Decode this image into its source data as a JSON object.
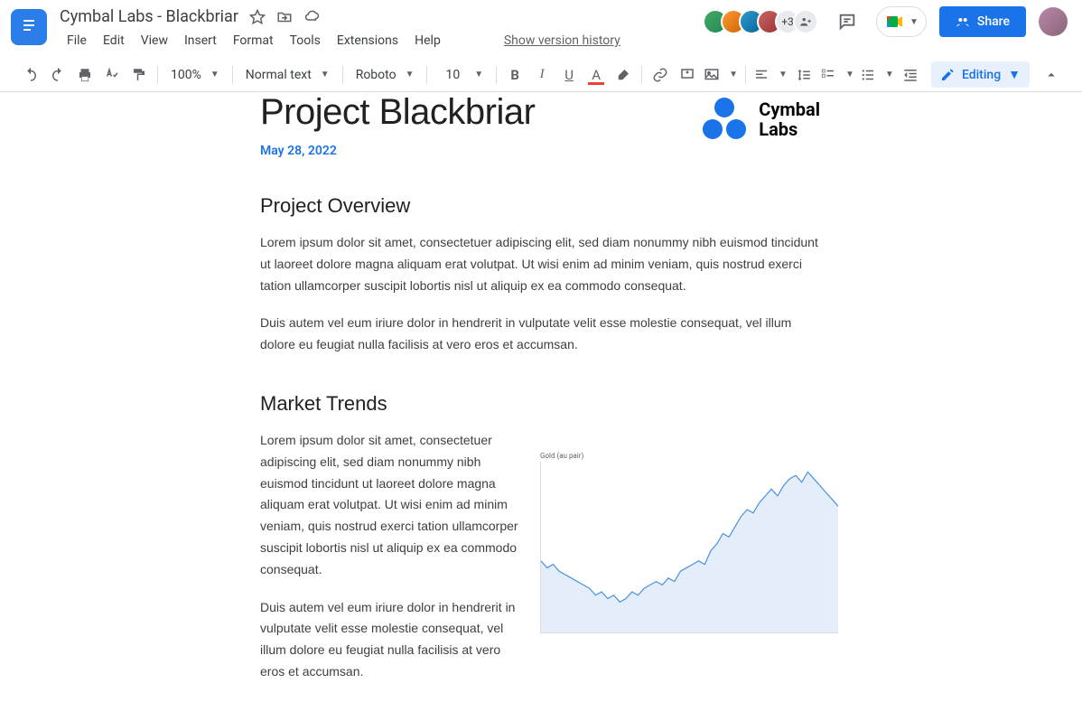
{
  "header": {
    "doc_title": "Cymbal Labs - Blackbriar",
    "menus": [
      "File",
      "Edit",
      "View",
      "Insert",
      "Format",
      "Tools",
      "Extensions",
      "Help"
    ],
    "version_link": "Show version history",
    "avatars_more": "+3",
    "share_label": "Share"
  },
  "toolbar": {
    "zoom": "100%",
    "style": "Normal text",
    "font": "Roboto",
    "font_size": "10",
    "editing_label": "Editing"
  },
  "document": {
    "title": "Project Blackbriar",
    "date": "May 28, 2022",
    "logo_text_1": "Cymbal",
    "logo_text_2": "Labs",
    "sections": [
      {
        "heading": "Project Overview",
        "paragraphs": [
          "Lorem ipsum dolor sit amet, consectetuer adipiscing elit, sed diam nonummy nibh euismod tincidunt ut laoreet dolore magna aliquam erat volutpat. Ut wisi enim ad minim veniam, quis nostrud exerci tation ullamcorper suscipit lobortis nisl ut aliquip ex ea commodo consequat.",
          "Duis autem vel eum iriure dolor in hendrerit in vulputate velit esse molestie consequat, vel illum dolore eu feugiat nulla facilisis at vero eros et accumsan."
        ]
      },
      {
        "heading": "Market Trends",
        "paragraphs": [
          "Lorem ipsum dolor sit amet, consectetuer adipiscing elit, sed diam nonummy nibh euismod tincidunt ut laoreet dolore magna aliquam erat volutpat. Ut wisi enim ad minim veniam, quis nostrud exerci tation ullamcorper suscipit lobortis nisl ut aliquip ex ea commodo consequat.",
          "Duis autem vel eum iriure dolor in hendrerit in vulputate velit esse molestie consequat, vel illum dolore eu feugiat nulla facilisis at vero eros et accumsan."
        ]
      }
    ]
  },
  "chart_data": {
    "type": "area",
    "title": "Gold (au pair)",
    "x": [
      0,
      1,
      2,
      3,
      4,
      5,
      6,
      7,
      8,
      9,
      10,
      11,
      12,
      13,
      14,
      15,
      16,
      17,
      18,
      19,
      20,
      21,
      22,
      23,
      24,
      25,
      26,
      27,
      28,
      29,
      30,
      31,
      32,
      33,
      34,
      35,
      36,
      37,
      38,
      39,
      40,
      41,
      42,
      43,
      44,
      45,
      46,
      47,
      48,
      49
    ],
    "values": [
      42,
      38,
      40,
      36,
      34,
      32,
      30,
      28,
      26,
      22,
      24,
      20,
      22,
      18,
      20,
      24,
      22,
      26,
      28,
      30,
      28,
      32,
      30,
      36,
      38,
      40,
      42,
      40,
      48,
      52,
      58,
      56,
      62,
      68,
      72,
      70,
      76,
      80,
      84,
      80,
      86,
      90,
      92,
      88,
      94,
      90,
      86,
      82,
      78,
      74
    ],
    "ylim": [
      0,
      100
    ],
    "color": "#4a90e2"
  }
}
